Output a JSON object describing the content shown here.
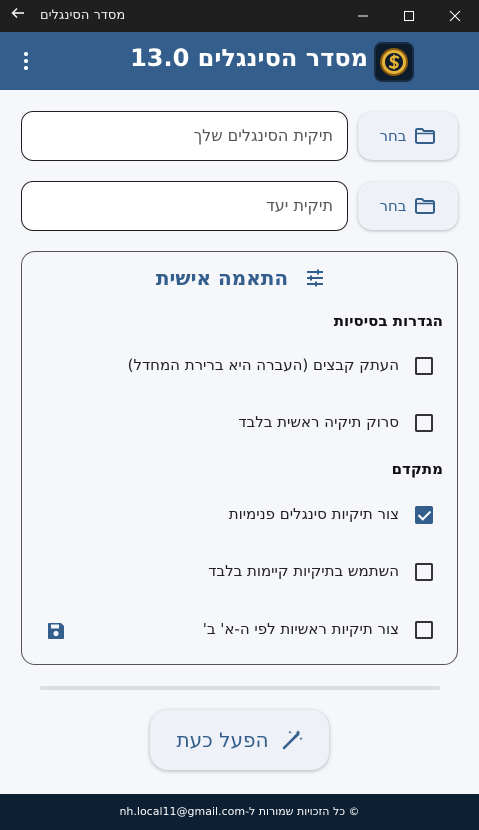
{
  "window": {
    "title": "מסדר הסינגלים"
  },
  "appbar": {
    "title": "מסדר הסינגלים 13.0"
  },
  "source": {
    "label": "תיקית הסינגלים שלך",
    "button": "בחר"
  },
  "target": {
    "label": "תיקית יעד",
    "button": "בחר"
  },
  "settings": {
    "title": "התאמה אישית",
    "basic_heading": "הגדרות בסיסיות",
    "basic": [
      {
        "label": "העתק קבצים (העברה היא ברירת המחדל)",
        "checked": false
      },
      {
        "label": "סרוק תיקיה ראשית בלבד",
        "checked": false
      }
    ],
    "advanced_heading": "מתקדם",
    "advanced": [
      {
        "label": "צור תיקיות סינגלים פנימיות",
        "checked": true
      },
      {
        "label": "השתמש בתיקיות קיימות בלבד",
        "checked": false
      },
      {
        "label": "צור תיקיות ראשיות לפי ה-א' ב'",
        "checked": false
      }
    ]
  },
  "run_button": {
    "label": "הפעל כעת"
  },
  "footer": {
    "text": "© כל הזכויות שמורות ל-nh.local11@gmail.com"
  },
  "colors": {
    "accent": "#345f8d",
    "footer_bg": "#0d1f33",
    "titlebar_bg": "#1f1f1f"
  }
}
